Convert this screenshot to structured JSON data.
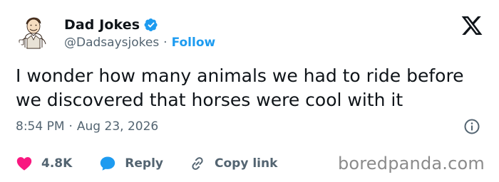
{
  "author": {
    "display_name": "Dad Jokes",
    "handle": "@Dadsaysjokes",
    "separator": "·",
    "follow_label": "Follow",
    "verified": true
  },
  "tweet": {
    "text_lines": [
      "I wonder how many animals we had to ride before",
      "we discovered that horses were cool with it"
    ],
    "time": "8:54 PM",
    "separator": "·",
    "date": "Aug 23, 2026"
  },
  "actions": {
    "likes_count": "4.8K",
    "reply_label": "Reply",
    "copy_link_label": "Copy link"
  },
  "watermark": "boredpanda.com",
  "icons": {
    "logo": "x-logo-icon",
    "verified": "verified-badge-icon",
    "info": "info-icon",
    "like": "heart-icon",
    "reply": "speech-bubble-icon",
    "copy": "link-icon"
  },
  "colors": {
    "text": "#0f1419",
    "secondary": "#536471",
    "accent": "#1d9bf0",
    "like": "#f91880",
    "watermark": "#8b8b8b"
  }
}
